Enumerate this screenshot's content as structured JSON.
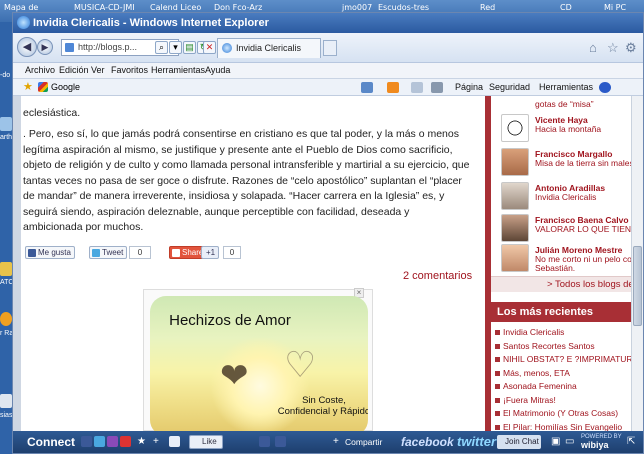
{
  "desktop": {
    "top_labels": [
      "Mapa de",
      "MUSICA-CD-JMI",
      "Calend Liceo",
      "Don Fco-Arz",
      "jmo007",
      "Escudos-tres",
      "Red",
      "CD",
      "Mi PC"
    ],
    "left_labels": [
      "-do",
      "arth",
      "ATC",
      "r Ra",
      "sias"
    ]
  },
  "window": {
    "title": "Invidia Clericalis - Windows Internet Explorer",
    "url": "http://blogs.p...",
    "tab_label": "Invidia Clericalis",
    "menu": [
      "Archivo",
      "Edición",
      "Ver",
      "Favoritos",
      "Herramientas",
      "Ayuda"
    ],
    "favorites": {
      "google_label": "Google"
    },
    "commands": {
      "page": "Página",
      "security": "Seguridad",
      "tools": "Herramientas"
    }
  },
  "article": {
    "p1": "eclesiástica.",
    "p2": ". Pero, eso sí, lo que jamás podrá consentirse en cristiano es que tal poder, y la más o menos legítima aspiración al mismo, se justifique y presente ante el Pueblo de Dios como sacrificio, objeto de religión y de culto y como llamada personal intransferible y martirial a su ejercicio, que tantas veces no pasa de ser goce o disfrute. Razones de “celo apostólico” suplantan el “placer de mandar” de manera irreverente, insidiosa y solapada. “Hacer carrera en la Iglesia” es, y seguirá siendo, aspiración deleznable, aunque perceptible con facilidad, deseada y ambicionada por muchos.",
    "social": {
      "fb": "Me gusta",
      "tweet": "Tweet",
      "tweet_count": "0",
      "share": "Share",
      "gplus": "+1",
      "gplus_count": "0"
    },
    "comments": "2 comentarios",
    "ad": {
      "title": "Hechizos de Amor",
      "subtitle": "Sin Coste, Confidencial y Rápido"
    }
  },
  "sidebar": {
    "first_title": "gotas de “misa”",
    "blogs": [
      {
        "name": "Vicente Haya",
        "title": "Hacia la montaña"
      },
      {
        "name": "Francisco Margallo",
        "title": "Misa de la tierra sin males"
      },
      {
        "name": "Antonio Aradillas",
        "title": "Invidia Clericalis"
      },
      {
        "name": "Francisco Baena Calvo",
        "title": "VALORAR LO QUE TIENES"
      },
      {
        "name": "Julián Moreno Mestre",
        "title": "No me corto ni un pelo con l",
        "title2": "Sebastián."
      }
    ],
    "todos": "> Todos los blogs de",
    "recent_head": "Los más recientes",
    "recent": [
      "Invidia Clericalis",
      "Santos Recortes Santos",
      "NIHIL OBSTAT? E ?IMPRIMATUR",
      "Más, menos, ETA",
      "Asonada Femenina",
      "¡Fuera Mitras!",
      "El Matrimonio (Y Otras Cosas)",
      "El Pilar: Homilías Sin Evangelio"
    ]
  },
  "wibiya": {
    "connect": "Connect",
    "like": "Like",
    "share": "Compartir",
    "facebook": "facebook",
    "twitter": "twitter",
    "join": "Join Chat",
    "powered": "POWERED BY",
    "brand": "wibiya"
  }
}
